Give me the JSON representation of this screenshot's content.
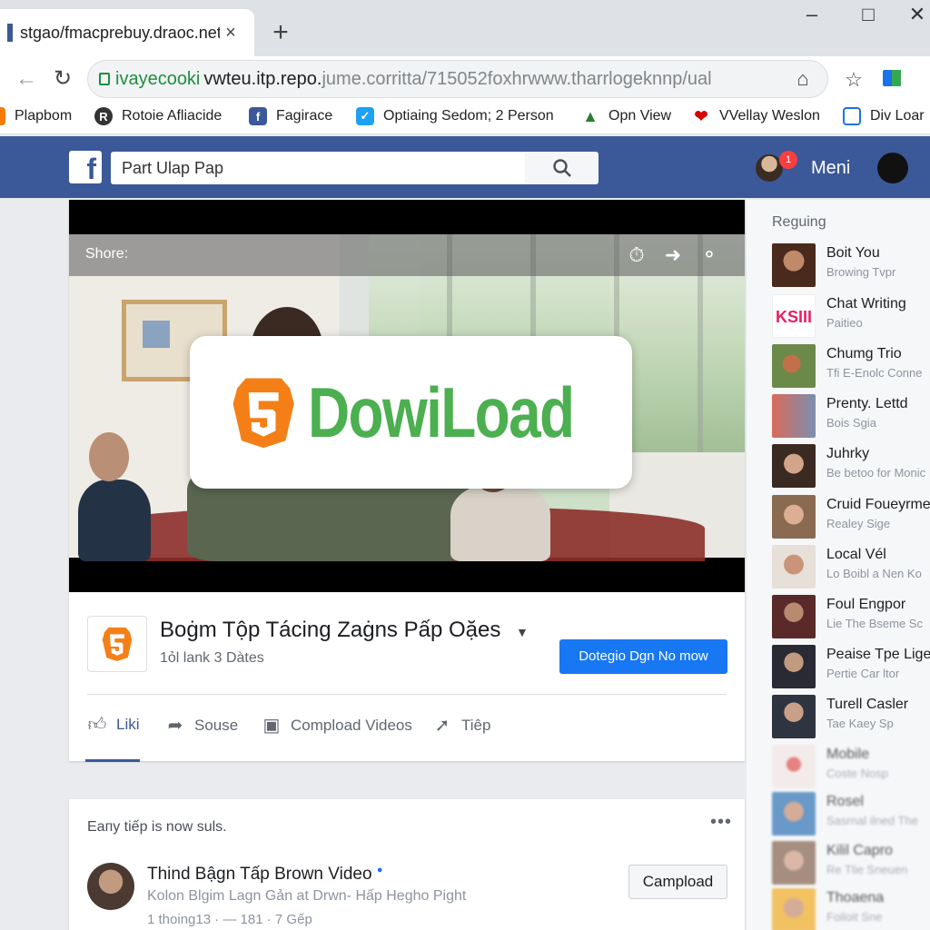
{
  "browser": {
    "tab_title": "stgao/fmacprebuy.draoc.net",
    "tab_close": "×",
    "new_tab": "+",
    "url_secure": "ivayecooki",
    "url_main": "vwteu.itp.repo.",
    "url_faded": "jume.corritta/715052foxhrwww.tharrlogeknnp/ual",
    "bookmarks": [
      "Plapbom",
      "Rotoie Afliacide",
      "Fagirace",
      "Optiaing Sedom; 2 Person",
      "Opn View",
      "VVellay Weslon",
      "Div Loar"
    ]
  },
  "facebook": {
    "search_value": "Part Ulap Pap",
    "menu_label": "Meni",
    "notification_count": "1",
    "brand_color": "#3b5998"
  },
  "video": {
    "share_label": "Shore:",
    "download_text": "DowiLoad",
    "page_title": "Boġm Tộp Tácing Zaġns Pấp Oặes",
    "page_sub": "1ỏl lank 3 Dàtes",
    "cta_label": "Dotegio Dgn No mow",
    "actions": [
      "Liki",
      "Souse",
      "Compload Videos",
      "Tiêp"
    ]
  },
  "post2": {
    "header": "Eапу tiếp is now suls.",
    "more": "•••",
    "title": "Thind Bậgn Tấp Brown Video",
    "description": "Kolon Blgim Lagn Gản at Drwn- Hấp Hegho Pight",
    "meta": "1 thoing13 · — 181 · 7 Gếp",
    "button": "Campload"
  },
  "sidebar": {
    "heading": "Reguing",
    "items": [
      {
        "name": "Boit You",
        "sub": "Browing Tvpr"
      },
      {
        "name": "Chat Writing",
        "sub": "Paitieo"
      },
      {
        "name": "Chumg Trio",
        "sub": "Tfi E-Enolc Conne"
      },
      {
        "name": "Prenty. Lettd",
        "sub": "Bois Sgia"
      },
      {
        "name": "Juhrky",
        "sub": "Be betoo for Monic"
      },
      {
        "name": "Cruid Foueyrme",
        "sub": "Realey Sige"
      },
      {
        "name": "Local Vél",
        "sub": "Lo Boibl a Nen Ko"
      },
      {
        "name": "Foul Engpor",
        "sub": "Lie The Bseme Sc"
      },
      {
        "name": "Peaise Tpe Liger",
        "sub": "Pertie Car ltor"
      },
      {
        "name": "Turell Casler",
        "sub": "Tae Kaey Sp"
      },
      {
        "name": "Mobile",
        "sub": "Coste Nosp"
      },
      {
        "name": "Rosel",
        "sub": "Sasrnal ilned The"
      },
      {
        "name": "Kilil Capro",
        "sub": "Re Tlie Sneuen"
      },
      {
        "name": "Thoaena",
        "sub": "Foiloit Sne"
      }
    ]
  }
}
